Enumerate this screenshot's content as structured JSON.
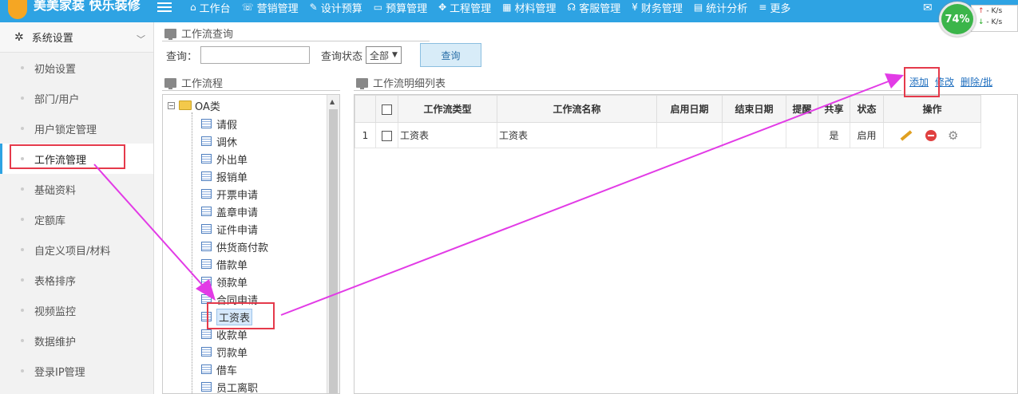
{
  "app": {
    "title": "美美家装 快乐装修",
    "nav": [
      {
        "label": "工作台",
        "icon": "home-icon",
        "glyph": "⌂"
      },
      {
        "label": "营销管理",
        "icon": "chat-icon",
        "glyph": "☏"
      },
      {
        "label": "设计预算",
        "icon": "edit-icon",
        "glyph": "✎"
      },
      {
        "label": "预算管理",
        "icon": "monitor-icon",
        "glyph": "▭"
      },
      {
        "label": "工程管理",
        "icon": "paw-icon",
        "glyph": "✥"
      },
      {
        "label": "材料管理",
        "icon": "grid-icon",
        "glyph": "▦"
      },
      {
        "label": "客服管理",
        "icon": "headset-icon",
        "glyph": "☊"
      },
      {
        "label": "财务管理",
        "icon": "yen-icon",
        "glyph": "¥"
      },
      {
        "label": "统计分析",
        "icon": "bar-chart-icon",
        "glyph": "▤"
      },
      {
        "label": "更多",
        "icon": "menu-icon",
        "glyph": "≡"
      }
    ]
  },
  "widget": {
    "percent": "74%",
    "up": "- K/s",
    "down": "- K/s"
  },
  "sidebar": {
    "header": "系统设置",
    "items": [
      "初始设置",
      "部门/用户",
      "用户锁定管理",
      "工作流管理",
      "基础资料",
      "定额库",
      "自定义项目/材料",
      "表格排序",
      "视频监控",
      "数据维护",
      "登录IP管理"
    ]
  },
  "query": {
    "section_title": "工作流查询",
    "search_label": "查询：",
    "status_label": "查询状态",
    "status_value": "全部",
    "button_label": "查询"
  },
  "workflow": {
    "section_title": "工作流程",
    "root": "OA类",
    "items": [
      "请假",
      "调休",
      "外出单",
      "报销单",
      "开票申请",
      "盖章申请",
      "证件申请",
      "供货商付款",
      "借款单",
      "领款单",
      "合同申请",
      "工资表",
      "收款单",
      "罚款单",
      "借车",
      "员工离职"
    ]
  },
  "detail": {
    "section_title": "工作流明细列表",
    "actions": {
      "add": "添加",
      "edit": "修改",
      "delete": "删除/批"
    },
    "columns": [
      "工作流类型",
      "工作流名称",
      "启用日期",
      "结束日期",
      "提醒",
      "共享",
      "状态",
      "操作"
    ],
    "rows": [
      {
        "index": "1",
        "type": "工资表",
        "name": "工资表",
        "start": "",
        "end": "",
        "remind": "",
        "shared": "是",
        "status": "启用"
      }
    ]
  },
  "colors": {
    "topbar": "#2ea3e3",
    "annotation": "#e53a4b",
    "arrow": "#e23be6"
  }
}
